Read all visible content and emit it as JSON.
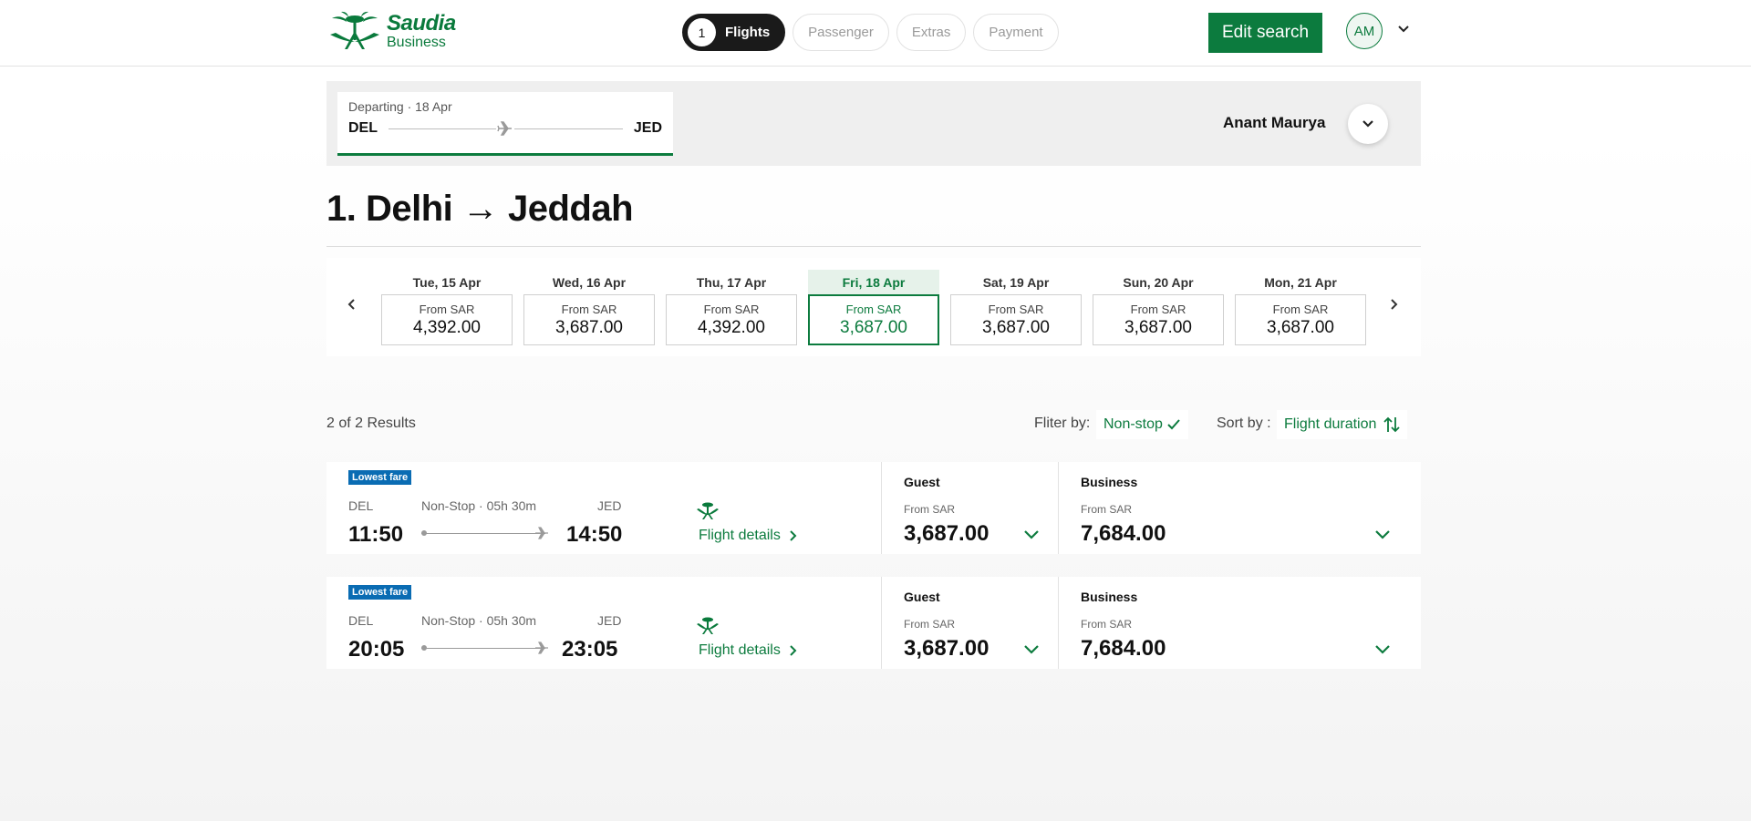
{
  "header": {
    "logo": {
      "name": "Saudia",
      "sub": "Business"
    },
    "steps": [
      {
        "num": "1",
        "label": "Flights"
      },
      {
        "label": "Passenger"
      },
      {
        "label": "Extras"
      },
      {
        "label": "Payment"
      }
    ],
    "edit_search_label": "Edit search",
    "avatar_initials": "AM"
  },
  "trip": {
    "departing_label": "Departing · 18 Apr",
    "origin": "DEL",
    "destination": "JED",
    "passenger_name": "Anant Maurya"
  },
  "route_title": "1. Delhi → Jeddah",
  "dates": [
    {
      "label": "Tue, 15 Apr",
      "from": "From SAR",
      "price": "4,392.00"
    },
    {
      "label": "Wed, 16 Apr",
      "from": "From SAR",
      "price": "3,687.00"
    },
    {
      "label": "Thu, 17 Apr",
      "from": "From SAR",
      "price": "4,392.00"
    },
    {
      "label": "Fri, 18 Apr",
      "from": "From SAR",
      "price": "3,687.00",
      "selected": true
    },
    {
      "label": "Sat, 19 Apr",
      "from": "From SAR",
      "price": "3,687.00"
    },
    {
      "label": "Sun, 20 Apr",
      "from": "From SAR",
      "price": "3,687.00"
    },
    {
      "label": "Mon, 21 Apr",
      "from": "From SAR",
      "price": "3,687.00"
    }
  ],
  "results": {
    "count": "2 of 2 Results",
    "filter_label": "Fliter by:",
    "filter_value": "Non-stop",
    "sort_label": "Sort by :",
    "sort_value": "Flight duration"
  },
  "flights": [
    {
      "badge": "Lowest fare",
      "from": "DEL",
      "to": "JED",
      "duration": "Non-Stop · 05h 30m",
      "depart": "11:50",
      "arrive": "14:50",
      "details_label": "Flight details",
      "guest": {
        "name": "Guest",
        "from": "From SAR",
        "price": "3,687.00"
      },
      "business": {
        "name": "Business",
        "from": "From SAR",
        "price": "7,684.00"
      }
    },
    {
      "badge": "Lowest fare",
      "from": "DEL",
      "to": "JED",
      "duration": "Non-Stop · 05h 30m",
      "depart": "20:05",
      "arrive": "23:05",
      "details_label": "Flight details",
      "guest": {
        "name": "Guest",
        "from": "From SAR",
        "price": "3,687.00"
      },
      "business": {
        "name": "Business",
        "from": "From SAR",
        "price": "7,684.00"
      }
    }
  ],
  "colors": {
    "brand_green": "#0c7b3e",
    "badge_blue": "#0a6cb3",
    "dark": "#1a1a1a"
  }
}
